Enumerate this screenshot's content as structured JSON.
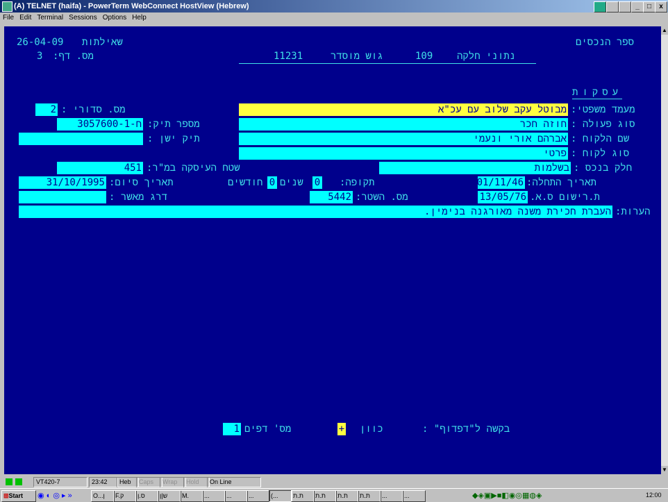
{
  "window": {
    "title": "(A) TELNET (haifa) - PowerTerm WebConnect HostView (Hebrew)",
    "controls": {
      "minimize": "_",
      "maximize": "□",
      "close": "x"
    }
  },
  "menu": [
    "File",
    "Edit",
    "Terminal",
    "Sessions",
    "Options",
    "Help"
  ],
  "screen": {
    "date": "26-04-09",
    "inquiries_label": "שאילתות",
    "book_title": "ספר הנכסים",
    "page_label": "מס. דף:",
    "page_value": "3",
    "property_label": "נתוני חלקה",
    "parcel_value": "109",
    "block_label": "גוש מוסדר",
    "block_value": "11231",
    "transactions_header": "עסקות",
    "serial_label": "מס. סדורי :",
    "serial_value": "2",
    "legal_status_label": "מעמד משפטי:",
    "legal_status_value": "מבוטל עקב שלוב עם עכ\"א",
    "file_no_label": "מספר תיק:",
    "file_no_value": "ח-3057600-1",
    "action_type_label": "סוג פעולה :",
    "action_type_value": "חוזה חכר",
    "old_file_label": "תיק ישן :",
    "old_file_value": "",
    "client_name_label": "שם הלקוח :",
    "client_name_value": "אברהם אורי ונעמי",
    "client_type_label": "סוג לקוח :",
    "client_type_value": "פרטי",
    "share_label": "חלק בנכס :",
    "share_value": "בשלמות",
    "area_label": "שטח העיסקה במ\"ר:",
    "area_value": "451",
    "start_date_label": "תאריך התחלה:",
    "start_date_value": "01/11/46",
    "period_label": "תקופה:",
    "years_value": "0",
    "years_label": "שנים",
    "months_value": "0",
    "months_label": "חודשים",
    "end_date_label": "תאריך סיום:",
    "end_date_value": "31/10/1995",
    "reg_date_label": "ת.רישום ס.א.",
    "reg_date_value": "13/05/76",
    "deed_no_label": "מס. השטר:",
    "deed_no_value": "5442",
    "approver_label": "דרג מאשר :",
    "approver_value": "",
    "notes_label": "הערות:",
    "notes_value": "העברת חכירת משנה מאורגנה בנימין.",
    "paging_prompt": "בקשה ל\"דפדוף\" :",
    "direction_label": "כוון",
    "direction_value": "+",
    "pages_label": "מס' דפים",
    "pages_value": "1"
  },
  "status": {
    "terminal": "VT420-7",
    "time": "23:42",
    "lang": "Heb",
    "caps": "Caps",
    "wrap": "Wrap",
    "hold": "Hold",
    "online": "On Line"
  },
  "taskbar": {
    "start": "Start",
    "clock": "12:00",
    "items": [
      "O...ן",
      "F.ק",
      "ס.ן",
      "ש|ן",
      "M.",
      "...",
      "...",
      "...",
      "(...",
      "ת.ת",
      "ת.ת",
      "ת.ת",
      "ת.ת",
      "...",
      "..."
    ]
  }
}
